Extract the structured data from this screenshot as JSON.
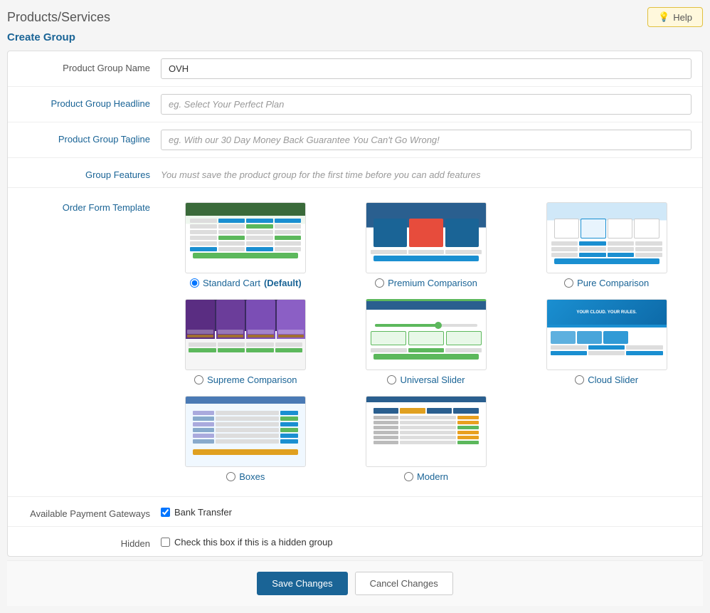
{
  "page": {
    "title": "Products/Services",
    "subtitle": "Create Group",
    "help_label": "Help"
  },
  "form": {
    "product_group_name_label": "Product Group Name",
    "product_group_name_value": "OVH",
    "product_group_headline_label": "Product Group Headline",
    "product_group_headline_placeholder": "eg. Select Your Perfect Plan",
    "product_group_tagline_label": "Product Group Tagline",
    "product_group_tagline_placeholder": "eg. With our 30 Day Money Back Guarantee You Can't Go Wrong!",
    "group_features_label": "Group Features",
    "group_features_notice": "You must save the product group for the first time before you can add features",
    "order_form_template_label": "Order Form Template",
    "templates": [
      {
        "id": "standard",
        "label": "Standard Cart",
        "extra": "(Default)",
        "selected": true
      },
      {
        "id": "premium",
        "label": "Premium Comparison",
        "selected": false
      },
      {
        "id": "pure",
        "label": "Pure Comparison",
        "selected": false
      },
      {
        "id": "supreme",
        "label": "Supreme Comparison",
        "selected": false
      },
      {
        "id": "universal",
        "label": "Universal Slider",
        "selected": false
      },
      {
        "id": "cloud",
        "label": "Cloud Slider",
        "selected": false
      },
      {
        "id": "boxes",
        "label": "Boxes",
        "selected": false
      },
      {
        "id": "modern",
        "label": "Modern",
        "selected": false
      }
    ],
    "available_payment_gateways_label": "Available Payment Gateways",
    "bank_transfer_label": "Bank Transfer",
    "bank_transfer_checked": true,
    "hidden_label": "Hidden",
    "hidden_checkbox_label": "Check this box if this is a hidden group",
    "hidden_checked": false,
    "save_button": "Save Changes",
    "cancel_button": "Cancel Changes"
  },
  "icons": {
    "help": "💡",
    "lightbulb": "💡"
  }
}
